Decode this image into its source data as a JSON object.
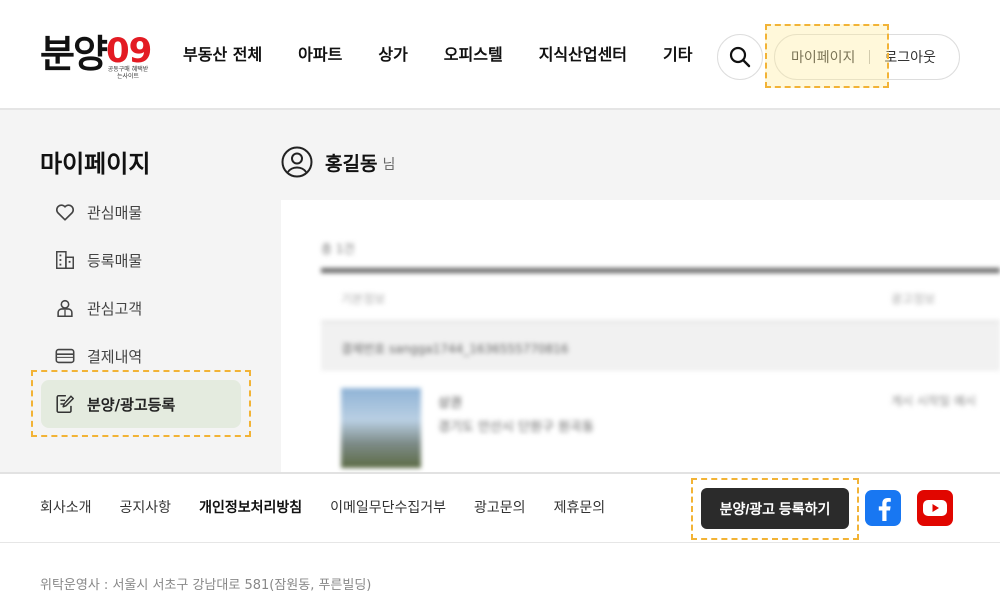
{
  "header": {
    "logo": {
      "main": "분양",
      "num": "09",
      "tagline": "공동구매 혜택받는사이트"
    },
    "nav": [
      "부동산 전체",
      "아파트",
      "상가",
      "오피스텔",
      "지식산업센터",
      "기타"
    ],
    "user_links": {
      "mypage": "마이페이지",
      "logout": "로그아웃"
    }
  },
  "sidebar": {
    "title": "마이페이지",
    "items": [
      {
        "label": "관심매물",
        "icon": "heart-icon"
      },
      {
        "label": "등록매물",
        "icon": "building-icon"
      },
      {
        "label": "관심고객",
        "icon": "user-icon"
      },
      {
        "label": "결제내역",
        "icon": "card-icon"
      },
      {
        "label": "분양/광고등록",
        "icon": "edit-icon",
        "active": true
      }
    ]
  },
  "profile": {
    "name": "홍길동",
    "suffix": "님"
  },
  "panel": {
    "label": "총 1건",
    "col_left": "기본정보",
    "col_right": "광고정보",
    "row_id": "결제번호 sangga1744_1636555770816",
    "item_line1": "상권",
    "item_line2": "경기도 안산시 단원구 원곡동",
    "item_right": "게시 시작일 예시"
  },
  "footer": {
    "links": [
      "회사소개",
      "공지사항",
      "개인정보처리방침",
      "이메일무단수집거부",
      "광고문의",
      "제휴문의"
    ],
    "cta": "분양/광고 등록하기",
    "info": "위탁운영사 : 서울시 서초구 강남대로 581(잠원동, 푸른빌딩)"
  },
  "colors": {
    "accent_red": "#e31b23",
    "highlight": "#f2b336",
    "active_bg": "#e4ebdf",
    "facebook": "#1877f2",
    "youtube": "#e10600"
  }
}
